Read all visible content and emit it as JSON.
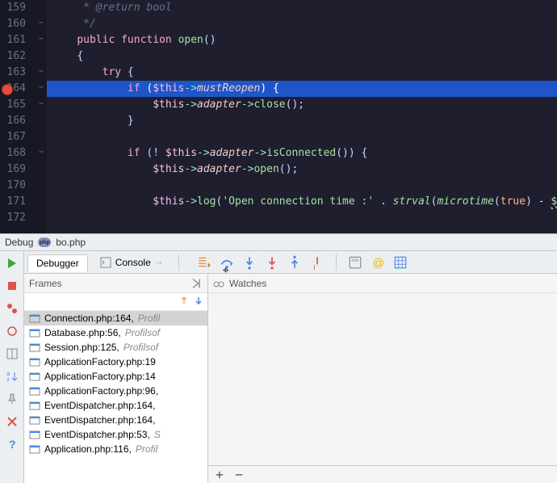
{
  "editor": {
    "lines": [
      {
        "n": 159
      },
      {
        "n": 160
      },
      {
        "n": 161
      },
      {
        "n": 162
      },
      {
        "n": 163
      },
      {
        "n": 164,
        "bp": true,
        "hl": true
      },
      {
        "n": 165
      },
      {
        "n": 166
      },
      {
        "n": 167
      },
      {
        "n": 168
      },
      {
        "n": 169
      },
      {
        "n": 170
      },
      {
        "n": 171
      },
      {
        "n": 172
      }
    ],
    "tokens": {
      "l159": "     * @return bool",
      "l160": "     */",
      "kw_public": "public",
      "kw_function": "function",
      "fn_open": "open",
      "brace_open": "{",
      "kw_try": "try",
      "kw_if": "if",
      "var_this": "$this",
      "arrow": "->",
      "mustReopen": "mustReopen",
      "adapter": "adapter",
      "close": "close",
      "brace_close": "}",
      "isConnected": "isConnected",
      "open": "open",
      "log": "log",
      "str_conn": "'Open connection time :'",
      "concat": " . ",
      "strval": "strval",
      "microtime": "microtime",
      "true": "true",
      "minus": " - ",
      "start": "$start",
      "bang": "! "
    }
  },
  "debug_header": {
    "title": "Debug",
    "file": "bo.php"
  },
  "tabs": {
    "debugger": "Debugger",
    "console": "Console"
  },
  "frames": {
    "title": "Frames",
    "items": [
      {
        "text": "Connection.php:164, ",
        "tail": "Profil",
        "sel": true
      },
      {
        "text": "Database.php:56, ",
        "tail": "Profilsof"
      },
      {
        "text": "Session.php:125, ",
        "tail": "Profilsof"
      },
      {
        "text": "ApplicationFactory.php:19",
        "tail": ""
      },
      {
        "text": "ApplicationFactory.php:14",
        "tail": ""
      },
      {
        "text": "ApplicationFactory.php:96,",
        "tail": ""
      },
      {
        "text": "EventDispatcher.php:164,",
        "tail": ""
      },
      {
        "text": "EventDispatcher.php:164,",
        "tail": ""
      },
      {
        "text": "EventDispatcher.php:53, ",
        "tail": "S"
      },
      {
        "text": "Application.php:116, ",
        "tail": "Profil"
      }
    ]
  },
  "watches": {
    "title": "Watches",
    "add": "+",
    "remove": "−"
  }
}
